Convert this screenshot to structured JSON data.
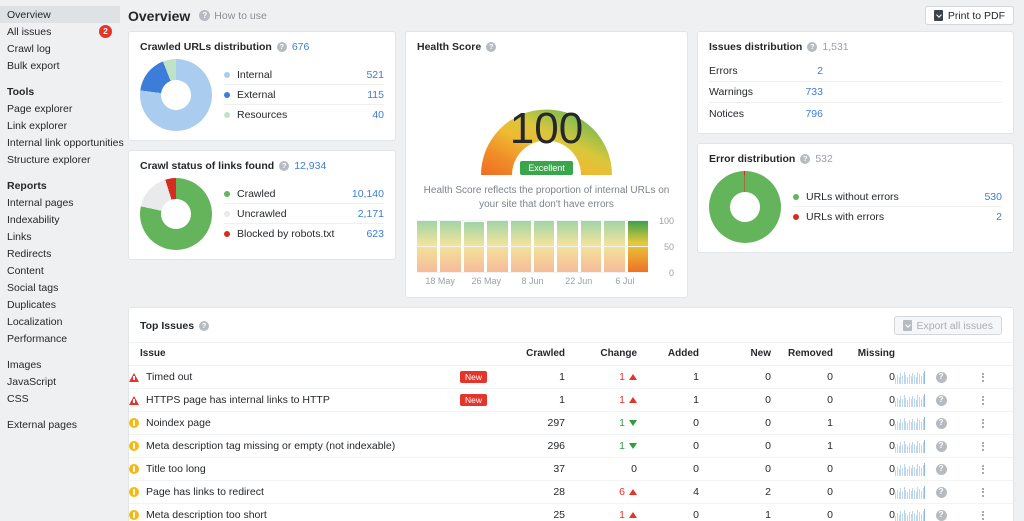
{
  "sidebar": {
    "items": [
      {
        "label": "Overview",
        "active": true,
        "badge": null,
        "type": "item"
      },
      {
        "label": "All issues",
        "active": false,
        "badge": "2",
        "type": "item"
      },
      {
        "label": "Crawl log",
        "active": false,
        "badge": null,
        "type": "item"
      },
      {
        "label": "Bulk export",
        "active": false,
        "badge": null,
        "type": "item"
      },
      {
        "label": "",
        "type": "spacer"
      },
      {
        "label": "Tools",
        "type": "group"
      },
      {
        "label": "Page explorer",
        "active": false,
        "badge": null,
        "type": "item"
      },
      {
        "label": "Link explorer",
        "active": false,
        "badge": null,
        "type": "item"
      },
      {
        "label": "Internal link opportunities",
        "active": false,
        "badge": null,
        "type": "item"
      },
      {
        "label": "Structure explorer",
        "active": false,
        "badge": null,
        "type": "item"
      },
      {
        "label": "",
        "type": "spacer"
      },
      {
        "label": "Reports",
        "type": "group"
      },
      {
        "label": "Internal pages",
        "active": false,
        "badge": null,
        "type": "item"
      },
      {
        "label": "Indexability",
        "active": false,
        "badge": null,
        "type": "item"
      },
      {
        "label": "Links",
        "active": false,
        "badge": null,
        "type": "item"
      },
      {
        "label": "Redirects",
        "active": false,
        "badge": null,
        "type": "item"
      },
      {
        "label": "Content",
        "active": false,
        "badge": null,
        "type": "item"
      },
      {
        "label": "Social tags",
        "active": false,
        "badge": null,
        "type": "item"
      },
      {
        "label": "Duplicates",
        "active": false,
        "badge": null,
        "type": "item"
      },
      {
        "label": "Localization",
        "active": false,
        "badge": null,
        "type": "item"
      },
      {
        "label": "Performance",
        "active": false,
        "badge": null,
        "type": "item"
      },
      {
        "label": "",
        "type": "spacer"
      },
      {
        "label": "Images",
        "active": false,
        "badge": null,
        "type": "item"
      },
      {
        "label": "JavaScript",
        "active": false,
        "badge": null,
        "type": "item"
      },
      {
        "label": "CSS",
        "active": false,
        "badge": null,
        "type": "item"
      },
      {
        "label": "",
        "type": "spacer"
      },
      {
        "label": "External pages",
        "active": false,
        "badge": null,
        "type": "item"
      }
    ]
  },
  "header": {
    "title": "Overview",
    "how_to_use": "How to use",
    "help_glyph": "?",
    "print_button": "Print to PDF"
  },
  "chart_data": [
    {
      "type": "pie",
      "title": "Crawled URLs distribution",
      "total": "676",
      "categories": [
        "Internal",
        "External",
        "Resources"
      ],
      "values": [
        521,
        115,
        40
      ],
      "colors": [
        "#aacdef",
        "#3b7dd8",
        "#bfe3c6"
      ],
      "value_labels": [
        "521",
        "115",
        "40"
      ]
    },
    {
      "type": "pie",
      "title": "Crawl status of links found",
      "total": "12,934",
      "categories": [
        "Crawled",
        "Uncrawled",
        "Blocked by robots.txt"
      ],
      "values": [
        10140,
        2171,
        623
      ],
      "colors": [
        "#64b45c",
        "#e8eaec",
        "#d62b1f"
      ],
      "value_labels": [
        "10,140",
        "2,171",
        "623"
      ]
    },
    {
      "type": "bar",
      "title": "Health Score",
      "score": "100",
      "rating": "Excellent",
      "description": "Health Score reflects the proportion of internal URLs on your site that don't have errors",
      "categories": [
        "18 May",
        "",
        "26 May",
        "",
        "8 Jun",
        "",
        "22 Jun",
        "",
        "6 Jul",
        ""
      ],
      "xticks": [
        "18 May",
        "26 May",
        "8 Jun",
        "22 Jun",
        "6 Jul"
      ],
      "values": [
        100,
        100,
        97,
        100,
        100,
        100,
        100,
        100,
        100,
        100
      ],
      "yticks": [
        "100",
        "50",
        "0"
      ],
      "ylim": [
        0,
        100
      ],
      "ylabel": "",
      "xlabel": ""
    },
    {
      "type": "bar",
      "title": "Issues distribution",
      "total": "1,531",
      "categories": [
        "Errors",
        "Warnings",
        "Notices"
      ],
      "values": [
        2,
        733,
        796
      ],
      "value_labels": [
        "2",
        "733",
        "796"
      ],
      "colors": [
        "#d62b1f",
        "#f5cb3c",
        "#3b7dd8"
      ],
      "orientation": "horizontal"
    },
    {
      "type": "pie",
      "title": "Error distribution",
      "total": "532",
      "categories": [
        "URLs without errors",
        "URLs with errors"
      ],
      "values": [
        530,
        2
      ],
      "colors": [
        "#64b45c",
        "#d62b1f"
      ],
      "value_labels": [
        "530",
        "2"
      ]
    }
  ],
  "top_issues": {
    "title": "Top Issues",
    "export_button": "Export all issues",
    "columns": [
      "Issue",
      "Crawled",
      "Change",
      "Added",
      "New",
      "Removed",
      "Missing"
    ],
    "rows": [
      {
        "severity": "error",
        "name": "Timed out",
        "is_new": true,
        "new_label": "New",
        "crawled": "1",
        "change": "1",
        "change_dir": "up",
        "added": "1",
        "added_state": "red",
        "new": "0",
        "new_state": "zero",
        "removed": "0",
        "removed_state": "zero",
        "missing": "0",
        "missing_state": "zero"
      },
      {
        "severity": "error",
        "name": "HTTPS page has internal links to HTTP",
        "is_new": true,
        "new_label": "New",
        "crawled": "1",
        "change": "1",
        "change_dir": "up",
        "added": "1",
        "added_state": "red",
        "new": "0",
        "new_state": "zero",
        "removed": "0",
        "removed_state": "zero",
        "missing": "0",
        "missing_state": "zero"
      },
      {
        "severity": "warning",
        "name": "Noindex page",
        "is_new": false,
        "new_label": "",
        "crawled": "297",
        "change": "1",
        "change_dir": "down",
        "added": "0",
        "added_state": "zero",
        "new": "0",
        "new_state": "zero",
        "removed": "1",
        "removed_state": "green",
        "missing": "0",
        "missing_state": "zero"
      },
      {
        "severity": "warning",
        "name": "Meta description tag missing or empty (not indexable)",
        "is_new": false,
        "new_label": "",
        "crawled": "296",
        "change": "1",
        "change_dir": "down",
        "added": "0",
        "added_state": "zero",
        "new": "0",
        "new_state": "zero",
        "removed": "1",
        "removed_state": "green",
        "missing": "0",
        "missing_state": "zero"
      },
      {
        "severity": "warning",
        "name": "Title too long",
        "is_new": false,
        "new_label": "",
        "crawled": "37",
        "change": "0",
        "change_dir": "none",
        "added": "0",
        "added_state": "zero",
        "new": "0",
        "new_state": "zero",
        "removed": "0",
        "removed_state": "zero",
        "missing": "0",
        "missing_state": "zero"
      },
      {
        "severity": "warning",
        "name": "Page has links to redirect",
        "is_new": false,
        "new_label": "",
        "crawled": "28",
        "change": "6",
        "change_dir": "up",
        "added": "4",
        "added_state": "red",
        "new": "2",
        "new_state": "red",
        "removed": "0",
        "removed_state": "zero",
        "missing": "0",
        "missing_state": "zero"
      },
      {
        "severity": "warning",
        "name": "Meta description too short",
        "is_new": false,
        "new_label": "",
        "crawled": "25",
        "change": "1",
        "change_dir": "up",
        "added": "0",
        "added_state": "zero",
        "new": "1",
        "new_state": "red",
        "removed": "0",
        "removed_state": "zero",
        "missing": "0",
        "missing_state": "zero"
      }
    ],
    "help_glyph": "?"
  }
}
